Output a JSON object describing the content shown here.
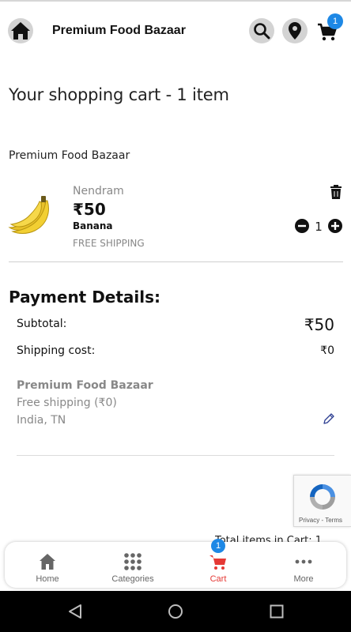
{
  "header": {
    "store_title": "Premium Food Bazaar",
    "cart_count": "1"
  },
  "cart": {
    "heading": "Your shopping cart - 1 item",
    "store_name": "Premium Food Bazaar",
    "item": {
      "variant": "Nendram",
      "price": "₹50",
      "name": "Banana",
      "shipping_note": "FREE SHIPPING",
      "quantity": "1"
    }
  },
  "payment": {
    "title": "Payment Details:",
    "subtotal_label": "Subtotal:",
    "subtotal_value": "₹50",
    "shipping_label": "Shipping cost:",
    "shipping_value": "₹0",
    "shipping_store": "Premium Food Bazaar",
    "shipping_method": "Free shipping (₹0)",
    "shipping_address": "India, TN",
    "total_peek": "Total items in Cart: 1"
  },
  "recaptcha": {
    "privacy": "Privacy",
    "terms": "Terms"
  },
  "bottom_nav": {
    "items": [
      {
        "label": "Home",
        "icon": "home-icon"
      },
      {
        "label": "Categories",
        "icon": "grid-icon"
      },
      {
        "label": "Cart",
        "icon": "cart-icon",
        "badge": "1"
      },
      {
        "label": "More",
        "icon": "more-icon"
      }
    ]
  },
  "colors": {
    "accent_blue": "#1e88e5",
    "active_red": "#e53935",
    "muted_text": "#888888"
  }
}
